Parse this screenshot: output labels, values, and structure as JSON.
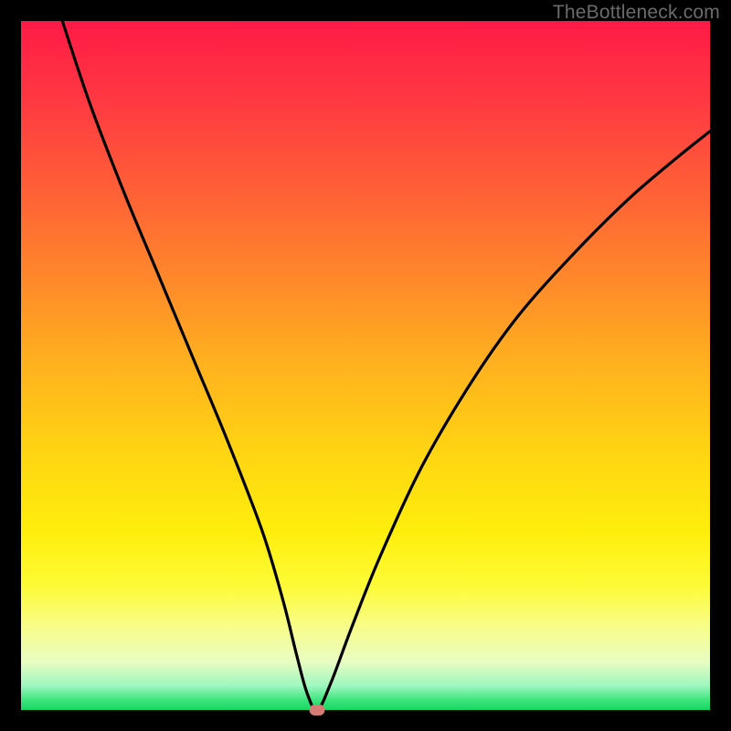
{
  "watermark": "TheBottleneck.com",
  "colors": {
    "curve": "#000000",
    "marker": "#d57d74",
    "frame_bg_top": "#ff1a46",
    "frame_bg_bottom": "#14d763"
  },
  "chart_data": {
    "type": "line",
    "title": "",
    "xlabel": "",
    "ylabel": "",
    "xlim": [
      0,
      100
    ],
    "ylim": [
      0,
      100
    ],
    "series": [
      {
        "name": "bottleneck_curve",
        "x": [
          6,
          10,
          15,
          20,
          25,
          30,
          35,
          38,
          40,
          41.5,
          43,
          45,
          48,
          52,
          58,
          65,
          72,
          80,
          88,
          95,
          100
        ],
        "values": [
          100,
          88,
          75,
          63,
          51,
          39,
          26,
          16,
          8,
          2.5,
          0,
          4,
          12,
          22,
          35,
          47,
          57,
          66,
          74,
          80,
          84
        ]
      }
    ],
    "marker": {
      "x": 43,
      "y": 0
    }
  }
}
